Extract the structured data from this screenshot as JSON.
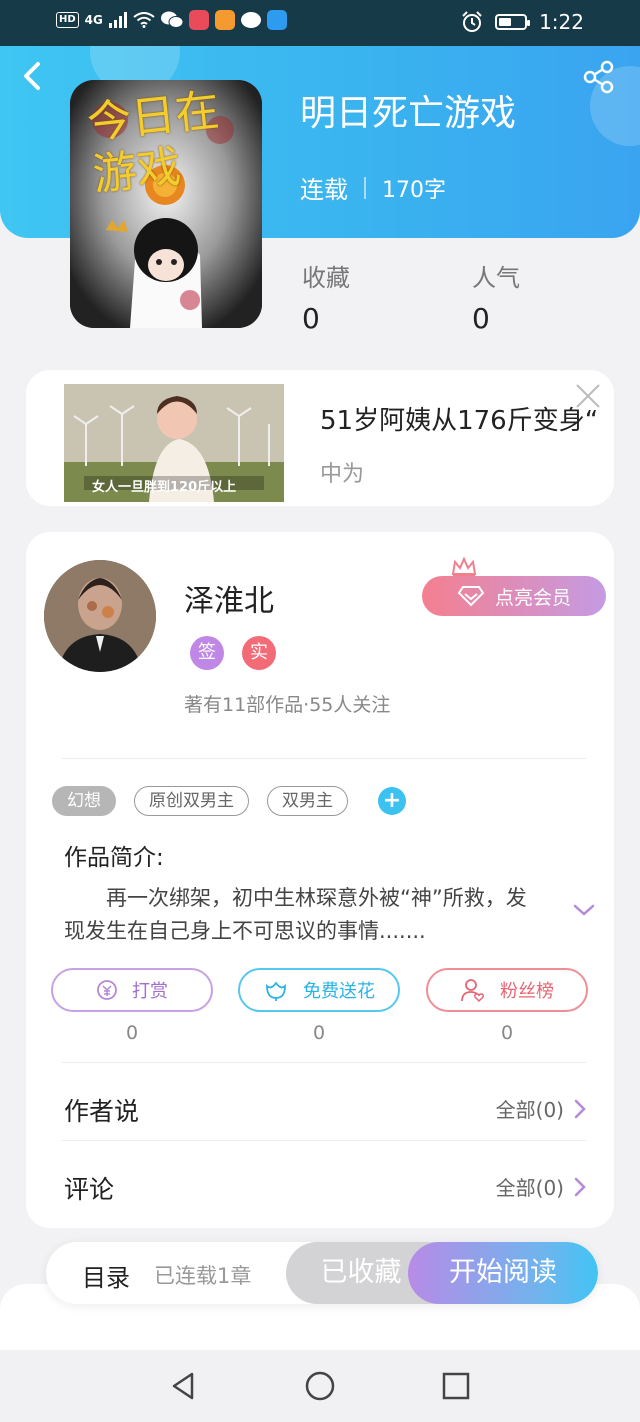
{
  "status_bar": {
    "hd": "HD",
    "signal": "4G",
    "time": "1:22",
    "apps": [
      "wechat-icon",
      "book-app-icon",
      "video-app-icon",
      "message-icon",
      "search-app-icon"
    ]
  },
  "header": {
    "back_icon": "back-arrow-icon",
    "share_icon": "share-icon",
    "book_title": "明日死亡游戏",
    "status": "连载",
    "word_count": "170字",
    "cover_art_text": "今日在游戏",
    "colors": {
      "accent": "#3ab2ef"
    }
  },
  "stats": {
    "favorites_label": "收藏",
    "favorites_value": "0",
    "popularity_label": "人气",
    "popularity_value": "0"
  },
  "ad": {
    "title": "51岁阿姨从176斤变身“",
    "subtitle": "中为",
    "image_caption_1": "女人一旦胖到120斤以上",
    "close_icon": "close-icon"
  },
  "author": {
    "name": "泽淮北",
    "badge_sign": "签",
    "badge_real": "实",
    "meta": "著有11部作品·55人关注",
    "vip_button": "点亮会员"
  },
  "tags": [
    "幻想",
    "原创双男主",
    "双男主"
  ],
  "intro": {
    "title": "作品简介:",
    "text": "再一次绑架，初中生林琛意外被“神”所救，发现发生在自己身上不可思议的事情......."
  },
  "actions": {
    "reward_label": "打赏",
    "reward_count": "0",
    "flower_label": "免费送花",
    "flower_count": "0",
    "fans_label": "粉丝榜",
    "fans_count": "0"
  },
  "rows": {
    "author_says": "作者说",
    "author_says_all": "全部(0)",
    "comments": "评论",
    "comments_all": "全部(0)"
  },
  "bottom": {
    "catalog": "目录",
    "chapters": "已连载1章",
    "favorited": "已收藏",
    "start_reading": "开始阅读"
  }
}
